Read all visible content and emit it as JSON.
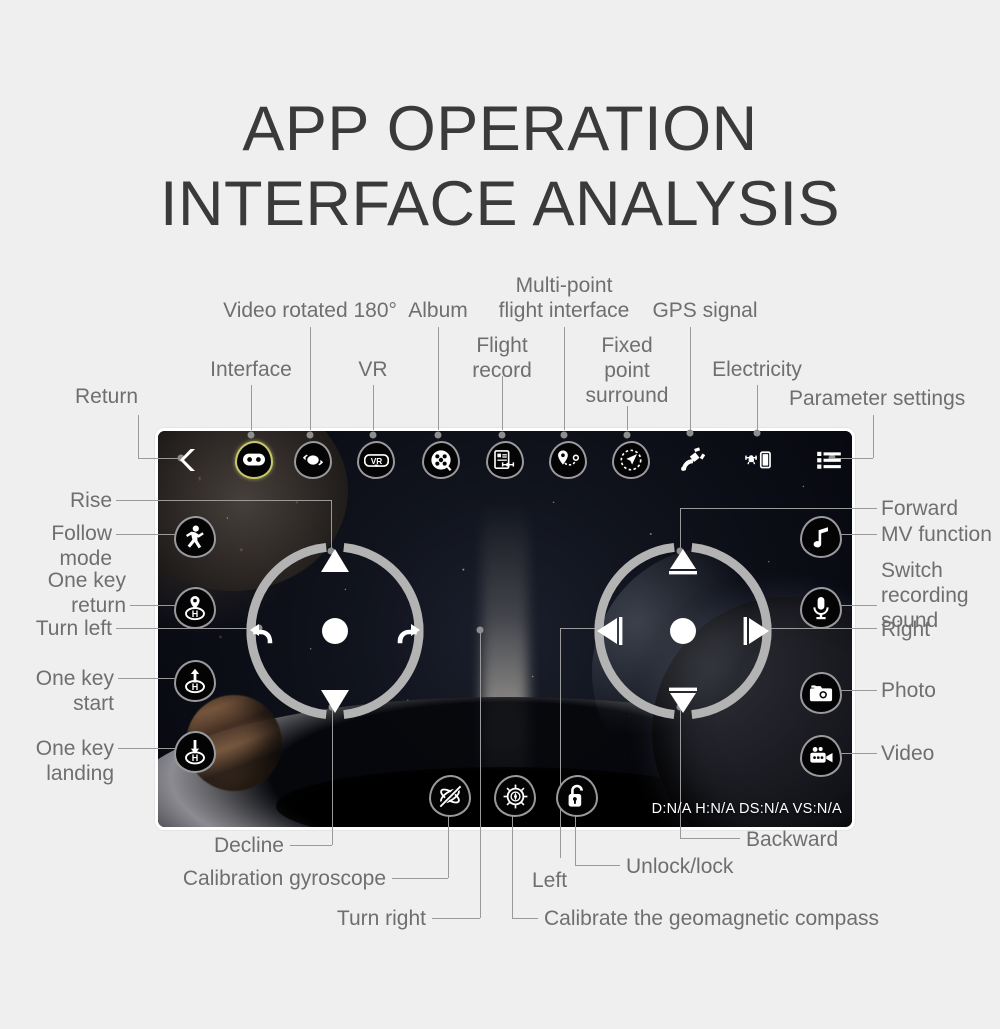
{
  "title": {
    "line1": "APP OPERATION",
    "line2": "INTERFACE ANALYSIS"
  },
  "screen": {
    "telemetry": "D:N/A H:N/A DS:N/A VS:N/A",
    "toolbar": [
      {
        "name": "return",
        "icon": "chevron-left-icon",
        "label": "Return"
      },
      {
        "name": "interface",
        "icon": "gamepad-icon",
        "label": "Interface"
      },
      {
        "name": "video-rotated-180",
        "icon": "video-rotate-icon",
        "label": "Video rotated 180°"
      },
      {
        "name": "vr",
        "icon": "vr-goggles-icon",
        "label": "VR"
      },
      {
        "name": "album",
        "icon": "album-icon",
        "label": "Album"
      },
      {
        "name": "flight-record",
        "icon": "flight-record-icon",
        "label": "Flight\nrecord"
      },
      {
        "name": "multi-point-flight",
        "icon": "waypoint-route-icon",
        "label": "Multi-point\nflight interface"
      },
      {
        "name": "fixed-point-surround",
        "icon": "orbit-surround-icon",
        "label": "Fixed\npoint\nsurround"
      },
      {
        "name": "gps-signal",
        "icon": "satellite-icon",
        "label": "GPS signal"
      },
      {
        "name": "electricity",
        "icon": "drone-battery-icon",
        "label": "Electricity"
      },
      {
        "name": "parameter-settings",
        "icon": "list-menu-icon",
        "label": "Parameter settings"
      }
    ],
    "left_controls": [
      {
        "name": "follow-mode",
        "icon": "follow-person-icon",
        "label": "Follow\nmode"
      },
      {
        "name": "one-key-return",
        "icon": "return-home-icon",
        "label": "One key\nreturn"
      },
      {
        "name": "one-key-start",
        "icon": "takeoff-home-icon",
        "label": "One key\nstart"
      },
      {
        "name": "one-key-landing",
        "icon": "landing-home-icon",
        "label": "One key\nlanding"
      }
    ],
    "right_controls": [
      {
        "name": "mv-function",
        "icon": "music-note-icon",
        "label": "MV function"
      },
      {
        "name": "switch-recording-sound",
        "icon": "microphone-icon",
        "label": "Switch\nrecording\nsound"
      },
      {
        "name": "photo",
        "icon": "camera-icon",
        "label": "Photo"
      },
      {
        "name": "video",
        "icon": "video-camera-icon",
        "label": "Video"
      }
    ],
    "bottom_controls": [
      {
        "name": "calibration-gyroscope",
        "icon": "gyroscope-icon",
        "label": "Calibration gyroscope"
      },
      {
        "name": "calibrate-compass",
        "icon": "compass-icon",
        "label": "Calibrate the geomagnetic compass"
      },
      {
        "name": "unlock-lock",
        "icon": "unlock-icon",
        "label": "Unlock/lock"
      }
    ],
    "left_dpad": [
      {
        "name": "rise",
        "icon": "triangle-up-icon",
        "label": "Rise"
      },
      {
        "name": "turn-left",
        "icon": "rotate-left-icon",
        "label": "Turn left"
      },
      {
        "name": "turn-right",
        "icon": "rotate-right-icon",
        "label": "Turn right"
      },
      {
        "name": "decline",
        "icon": "triangle-down-icon",
        "label": "Decline"
      }
    ],
    "right_dpad": [
      {
        "name": "forward",
        "icon": "triangle-up-icon",
        "label": "Forward"
      },
      {
        "name": "left",
        "icon": "triangle-left-icon",
        "label": "Left"
      },
      {
        "name": "right",
        "icon": "triangle-right-icon",
        "label": "Right"
      },
      {
        "name": "backward",
        "icon": "triangle-down-icon",
        "label": "Backward"
      }
    ]
  },
  "colors": {
    "page_background": "#efefef",
    "title_text": "#3a3a3a",
    "label_text": "#6f6f6f",
    "leader_line": "#9a9a9a",
    "highlight_ring": "#c8c86a",
    "blob_border": "#9a9a9e",
    "blob_fill": "#040405"
  }
}
